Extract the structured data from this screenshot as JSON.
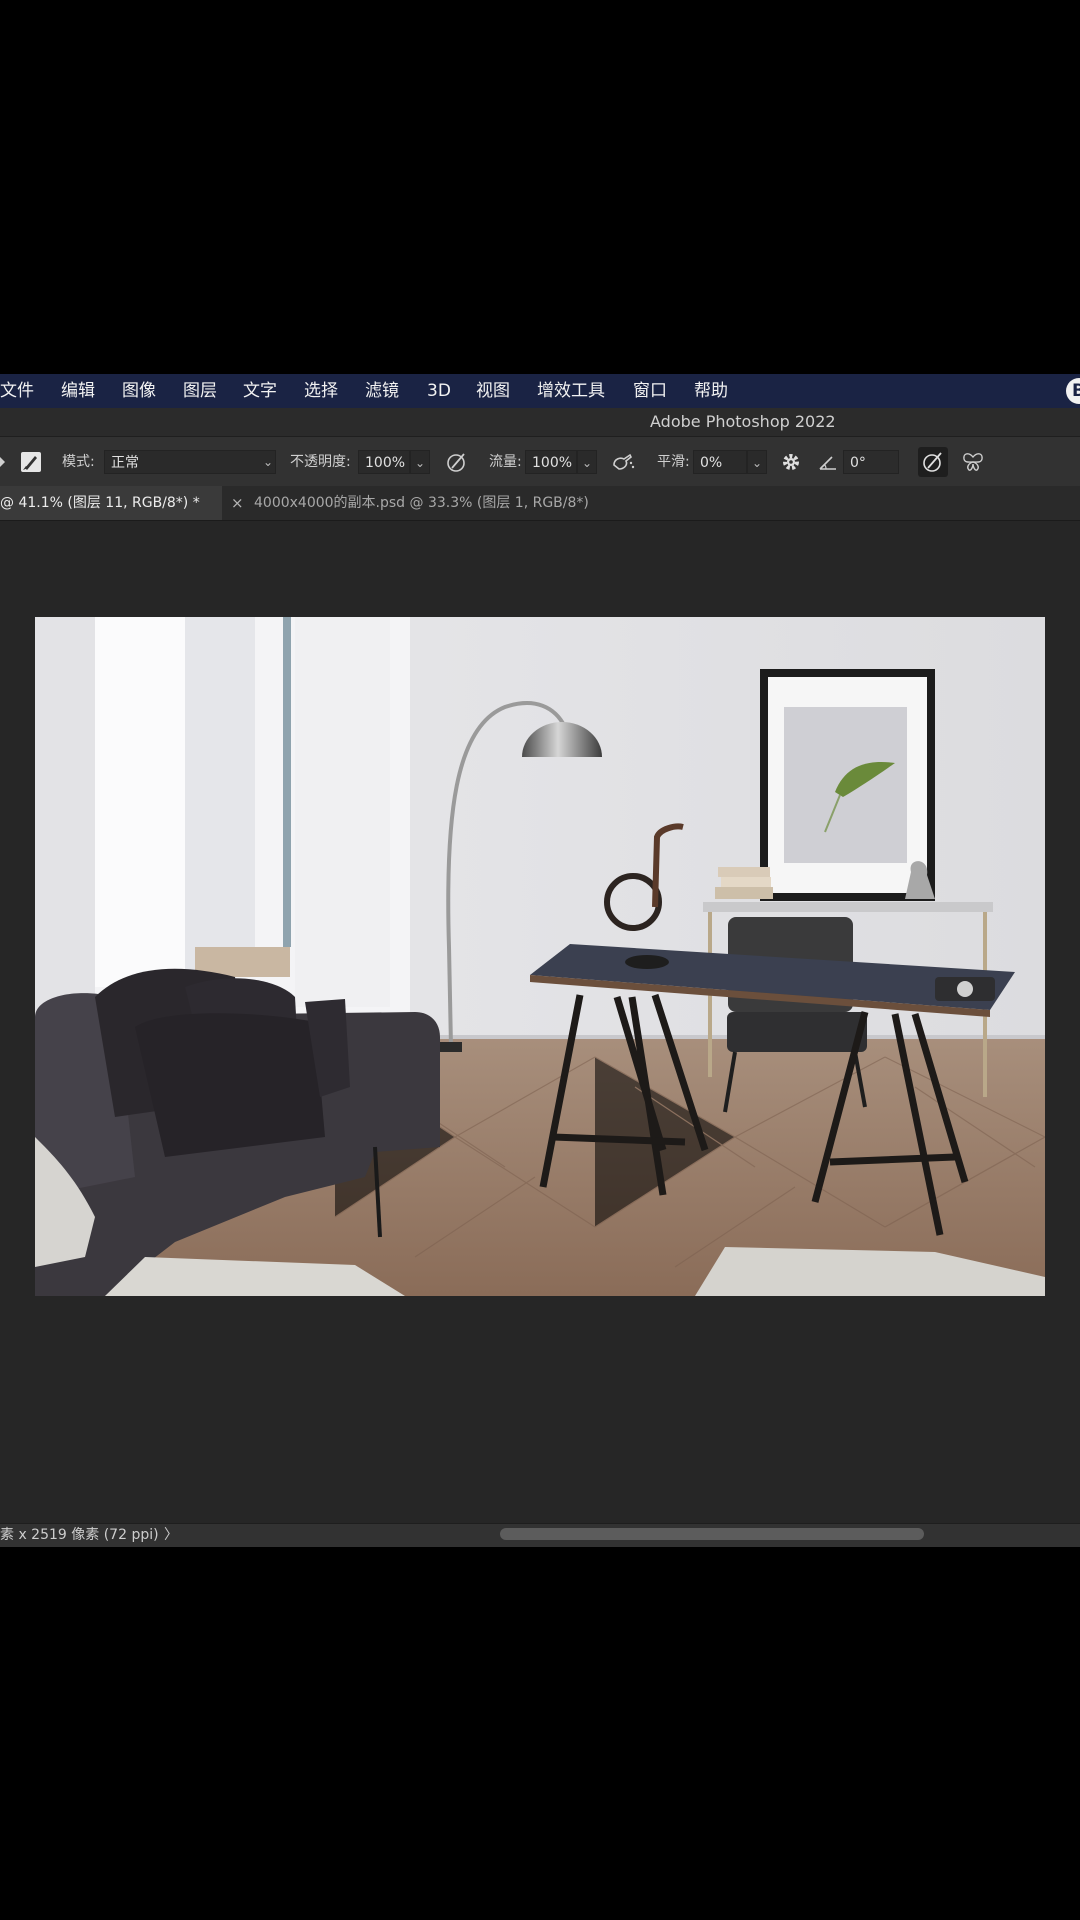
{
  "menubar": {
    "items": [
      "文件",
      "编辑",
      "图像",
      "图层",
      "文字",
      "选择",
      "滤镜",
      "3D",
      "视图",
      "增效工具",
      "窗口",
      "帮助"
    ]
  },
  "titlebar": {
    "title": "Adobe Photoshop 2022"
  },
  "options": {
    "mode_label": "模式:",
    "mode_value": "正常",
    "opacity_label": "不透明度:",
    "opacity_value": "100%",
    "flow_label": "流量:",
    "flow_value": "100%",
    "smoothing_label": "平滑:",
    "smoothing_value": "0%",
    "angle_value": "0°"
  },
  "tabs": {
    "active": "@ 41.1% (图层 11, RGB/8*) *",
    "close": "×",
    "inactive": "4000x4000的副本.psd @ 33.3% (图层 1, RGB/8*)"
  },
  "status": {
    "info": "素 x 2519 像素 (72 ppi)",
    "arrow": "〉"
  },
  "colors": {
    "menubar": "#1a2344",
    "workspace": "#262626",
    "options_bar": "#323232"
  }
}
